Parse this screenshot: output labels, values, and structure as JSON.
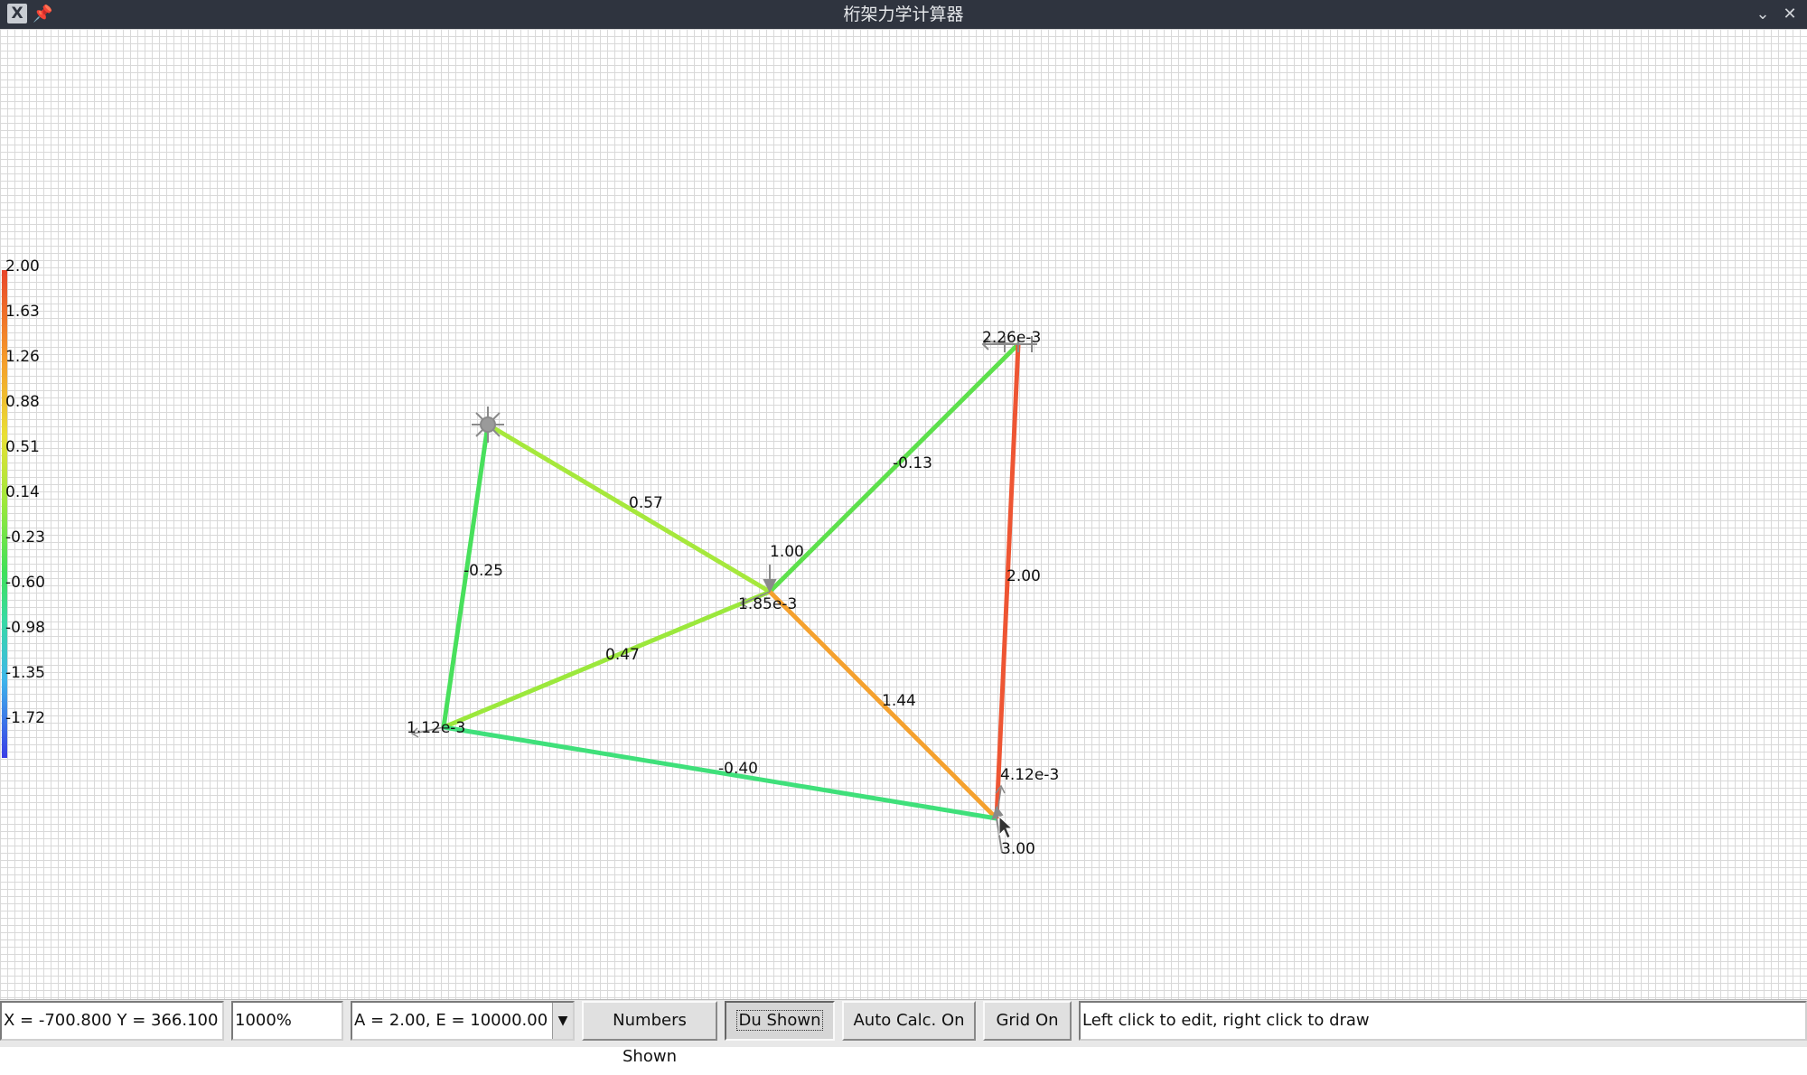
{
  "window": {
    "title": "桁架力学计算器",
    "app_icon": "X",
    "pin_icon": "pin-icon",
    "minimize_icon": "chevron-down-icon",
    "close_icon": "close-icon"
  },
  "color_scale": {
    "labels": [
      "2.00",
      "1.63",
      "1.26",
      "0.88",
      "0.51",
      "0.14",
      "-0.23",
      "-0.60",
      "-0.98",
      "-1.35",
      "-1.72"
    ],
    "max": 2.0,
    "min": -2.0,
    "colors": [
      "#e8452a",
      "#f59a2a",
      "#e9e035",
      "#9be83c",
      "#3fe05a",
      "#38d9a5",
      "#3fb6ea",
      "#3a3de6"
    ]
  },
  "truss": {
    "members": [
      {
        "label": "0.57",
        "color": "#a6e83c"
      },
      {
        "label": "-0.25",
        "color": "#48e05c"
      },
      {
        "label": "0.47",
        "color": "#9be83c"
      },
      {
        "label": "-0.13",
        "color": "#5de04c"
      },
      {
        "label": "1.44",
        "color": "#f5a12e"
      },
      {
        "label": "2.00",
        "color": "#ee5533"
      },
      {
        "label": "-0.40",
        "color": "#3fe07a"
      }
    ],
    "node_labels": [
      "2.26e-3",
      "1.85e-3",
      "1.12e-3",
      "4.12e-3"
    ],
    "loads": [
      "1.00",
      "3.00"
    ]
  },
  "statusbar": {
    "coords": "X = -700.800 Y = 366.100",
    "zoom": "1000%",
    "material": "A = 2.00, E = 10000.00",
    "numbers_button": "Numbers Shown",
    "du_button": "Du Shown",
    "autocalc_button": "Auto Calc. On",
    "grid_button": "Grid On",
    "hint": "Left click to edit, right click to draw"
  }
}
